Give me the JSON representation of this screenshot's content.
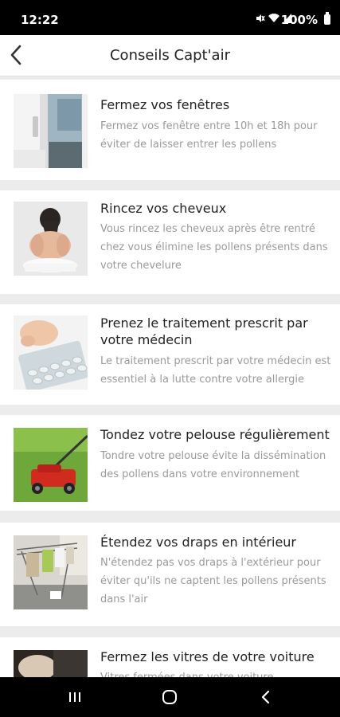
{
  "status_bar": {
    "time": "12:22",
    "battery": "100%",
    "icons": [
      "mute-icon",
      "wifi-icon",
      "signal-icon",
      "battery-icon"
    ]
  },
  "app_bar": {
    "title": "Conseils Capt'air",
    "back_icon": "chevron-left-icon"
  },
  "tips": [
    {
      "title": "Fermez vos fenêtres",
      "description": "Fermez vos fenêtre entre 10h et 18h pour éviter de laisser entrer les pollens",
      "image": "window-photo"
    },
    {
      "title": "Rincez vos cheveux",
      "description": "Vous rincez les cheveux après être rentré chez vous élimine les pollens présents dans votre chevelure",
      "image": "hair-washing-photo"
    },
    {
      "title": "Prenez le traitement prescrit par votre médecin",
      "description": "Le traitement prescrit par votre médecin est essentiel à la lutte contre votre allergie",
      "image": "pills-photo"
    },
    {
      "title": "Tondez votre pelouse régulièrement",
      "description": "Tondre votre pelouse évite la dissémination des pollens dans votre environnement",
      "image": "lawn-mower-photo"
    },
    {
      "title": "Étendez vos draps en intérieur",
      "description": "N'étendez pas vos draps à l'extérieur pour éviter qu'ils ne captent les pollens présents dans l'air",
      "image": "drying-rack-photo"
    },
    {
      "title": "Fermez les vitres de votre voiture",
      "description": "Vitres fermées dans votre voiture",
      "image": "car-photo"
    }
  ],
  "nav_bar": {
    "buttons": [
      "recent-apps-icon",
      "home-icon",
      "back-icon"
    ]
  }
}
